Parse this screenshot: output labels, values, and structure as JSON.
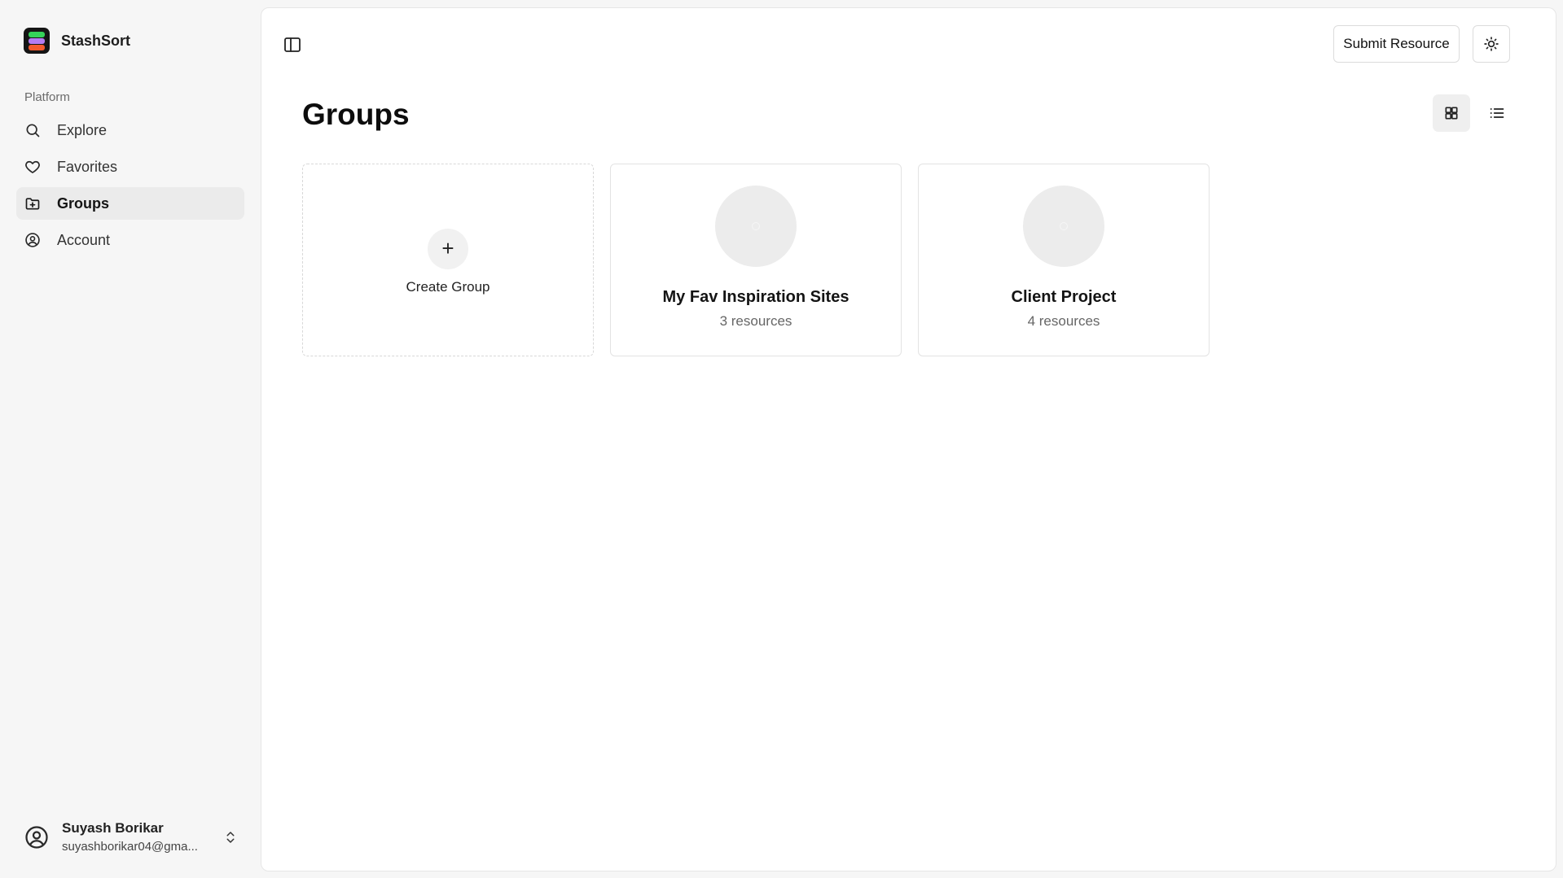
{
  "app": {
    "name": "StashSort",
    "accent_colors": [
      "#35d25a",
      "#b57cf2",
      "#f45a2d"
    ]
  },
  "sidebar": {
    "section_label": "Platform",
    "items": [
      {
        "label": "Explore",
        "icon": "search-icon",
        "active": false
      },
      {
        "label": "Favorites",
        "icon": "heart-icon",
        "active": false
      },
      {
        "label": "Groups",
        "icon": "folder-plus-icon",
        "active": true
      },
      {
        "label": "Account",
        "icon": "user-circle-icon",
        "active": false
      }
    ],
    "user": {
      "name": "Suyash Borikar",
      "email": "suyashborikar04@gma..."
    }
  },
  "header": {
    "submit_label": "Submit Resource",
    "theme_icon": "sun-icon",
    "sidebar_toggle_icon": "panel-left-icon"
  },
  "main": {
    "title": "Groups",
    "view_modes": [
      {
        "icon": "grid-icon",
        "active": true
      },
      {
        "icon": "list-icon",
        "active": false
      }
    ],
    "create_label": "Create Group",
    "groups": [
      {
        "name": "My Fav Inspiration Sites",
        "count": "3 resources"
      },
      {
        "name": "Client Project",
        "count": "4 resources"
      }
    ]
  }
}
